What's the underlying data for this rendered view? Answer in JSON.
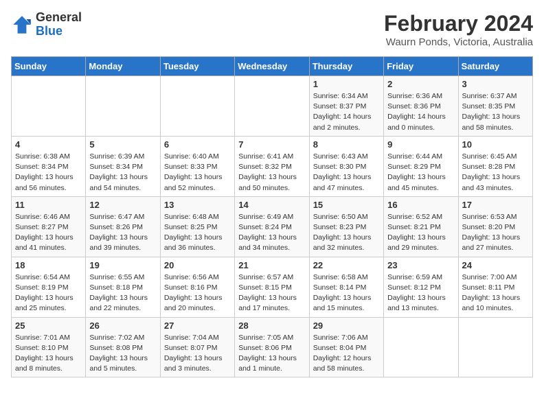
{
  "logo": {
    "line1": "General",
    "line2": "Blue"
  },
  "title": "February 2024",
  "subtitle": "Waurn Ponds, Victoria, Australia",
  "days_header": [
    "Sunday",
    "Monday",
    "Tuesday",
    "Wednesday",
    "Thursday",
    "Friday",
    "Saturday"
  ],
  "weeks": [
    [
      {
        "day": "",
        "info": ""
      },
      {
        "day": "",
        "info": ""
      },
      {
        "day": "",
        "info": ""
      },
      {
        "day": "",
        "info": ""
      },
      {
        "day": "1",
        "info": "Sunrise: 6:34 AM\nSunset: 8:37 PM\nDaylight: 14 hours\nand 2 minutes."
      },
      {
        "day": "2",
        "info": "Sunrise: 6:36 AM\nSunset: 8:36 PM\nDaylight: 14 hours\nand 0 minutes."
      },
      {
        "day": "3",
        "info": "Sunrise: 6:37 AM\nSunset: 8:35 PM\nDaylight: 13 hours\nand 58 minutes."
      }
    ],
    [
      {
        "day": "4",
        "info": "Sunrise: 6:38 AM\nSunset: 8:34 PM\nDaylight: 13 hours\nand 56 minutes."
      },
      {
        "day": "5",
        "info": "Sunrise: 6:39 AM\nSunset: 8:34 PM\nDaylight: 13 hours\nand 54 minutes."
      },
      {
        "day": "6",
        "info": "Sunrise: 6:40 AM\nSunset: 8:33 PM\nDaylight: 13 hours\nand 52 minutes."
      },
      {
        "day": "7",
        "info": "Sunrise: 6:41 AM\nSunset: 8:32 PM\nDaylight: 13 hours\nand 50 minutes."
      },
      {
        "day": "8",
        "info": "Sunrise: 6:43 AM\nSunset: 8:30 PM\nDaylight: 13 hours\nand 47 minutes."
      },
      {
        "day": "9",
        "info": "Sunrise: 6:44 AM\nSunset: 8:29 PM\nDaylight: 13 hours\nand 45 minutes."
      },
      {
        "day": "10",
        "info": "Sunrise: 6:45 AM\nSunset: 8:28 PM\nDaylight: 13 hours\nand 43 minutes."
      }
    ],
    [
      {
        "day": "11",
        "info": "Sunrise: 6:46 AM\nSunset: 8:27 PM\nDaylight: 13 hours\nand 41 minutes."
      },
      {
        "day": "12",
        "info": "Sunrise: 6:47 AM\nSunset: 8:26 PM\nDaylight: 13 hours\nand 39 minutes."
      },
      {
        "day": "13",
        "info": "Sunrise: 6:48 AM\nSunset: 8:25 PM\nDaylight: 13 hours\nand 36 minutes."
      },
      {
        "day": "14",
        "info": "Sunrise: 6:49 AM\nSunset: 8:24 PM\nDaylight: 13 hours\nand 34 minutes."
      },
      {
        "day": "15",
        "info": "Sunrise: 6:50 AM\nSunset: 8:23 PM\nDaylight: 13 hours\nand 32 minutes."
      },
      {
        "day": "16",
        "info": "Sunrise: 6:52 AM\nSunset: 8:21 PM\nDaylight: 13 hours\nand 29 minutes."
      },
      {
        "day": "17",
        "info": "Sunrise: 6:53 AM\nSunset: 8:20 PM\nDaylight: 13 hours\nand 27 minutes."
      }
    ],
    [
      {
        "day": "18",
        "info": "Sunrise: 6:54 AM\nSunset: 8:19 PM\nDaylight: 13 hours\nand 25 minutes."
      },
      {
        "day": "19",
        "info": "Sunrise: 6:55 AM\nSunset: 8:18 PM\nDaylight: 13 hours\nand 22 minutes."
      },
      {
        "day": "20",
        "info": "Sunrise: 6:56 AM\nSunset: 8:16 PM\nDaylight: 13 hours\nand 20 minutes."
      },
      {
        "day": "21",
        "info": "Sunrise: 6:57 AM\nSunset: 8:15 PM\nDaylight: 13 hours\nand 17 minutes."
      },
      {
        "day": "22",
        "info": "Sunrise: 6:58 AM\nSunset: 8:14 PM\nDaylight: 13 hours\nand 15 minutes."
      },
      {
        "day": "23",
        "info": "Sunrise: 6:59 AM\nSunset: 8:12 PM\nDaylight: 13 hours\nand 13 minutes."
      },
      {
        "day": "24",
        "info": "Sunrise: 7:00 AM\nSunset: 8:11 PM\nDaylight: 13 hours\nand 10 minutes."
      }
    ],
    [
      {
        "day": "25",
        "info": "Sunrise: 7:01 AM\nSunset: 8:10 PM\nDaylight: 13 hours\nand 8 minutes."
      },
      {
        "day": "26",
        "info": "Sunrise: 7:02 AM\nSunset: 8:08 PM\nDaylight: 13 hours\nand 5 minutes."
      },
      {
        "day": "27",
        "info": "Sunrise: 7:04 AM\nSunset: 8:07 PM\nDaylight: 13 hours\nand 3 minutes."
      },
      {
        "day": "28",
        "info": "Sunrise: 7:05 AM\nSunset: 8:06 PM\nDaylight: 13 hours\nand 1 minute."
      },
      {
        "day": "29",
        "info": "Sunrise: 7:06 AM\nSunset: 8:04 PM\nDaylight: 12 hours\nand 58 minutes."
      },
      {
        "day": "",
        "info": ""
      },
      {
        "day": "",
        "info": ""
      }
    ]
  ]
}
